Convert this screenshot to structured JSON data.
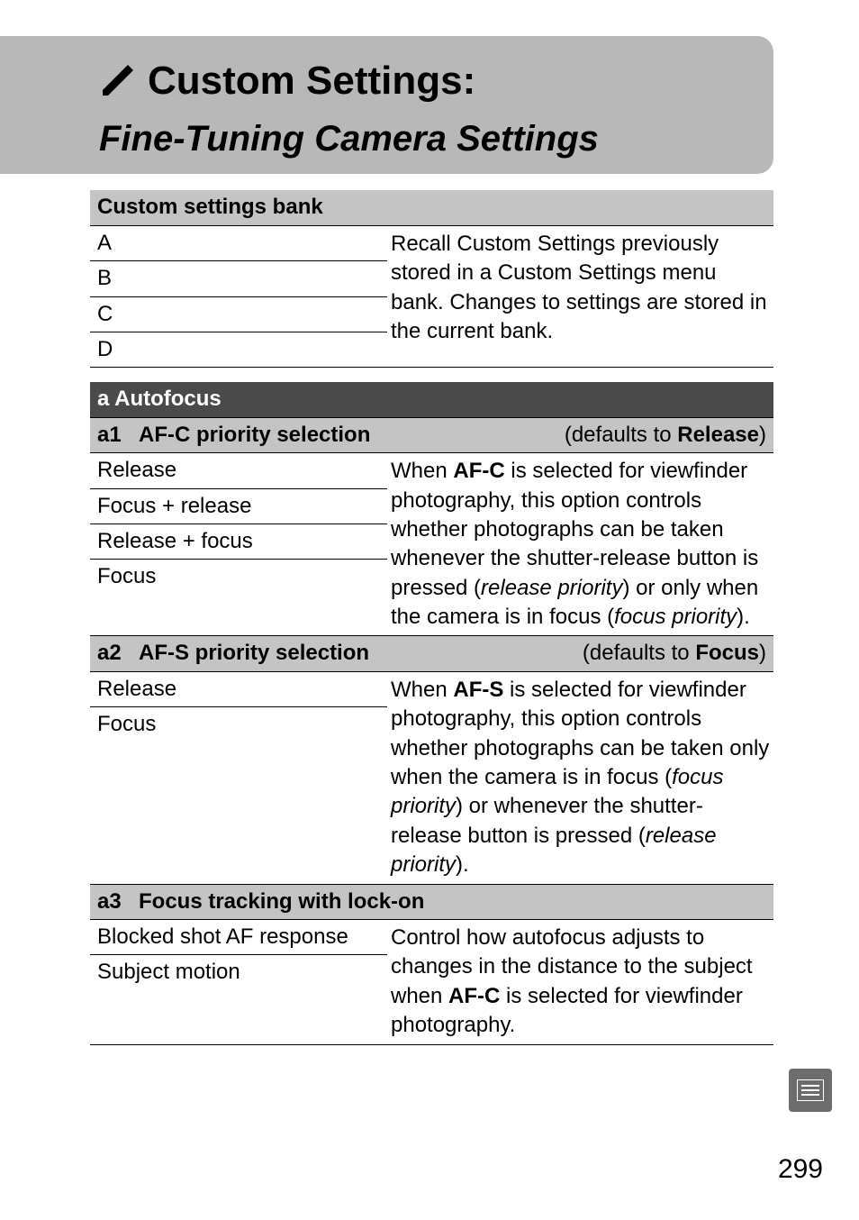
{
  "header": {
    "title": "Custom Settings:",
    "subtitle": "Fine-Tuning Camera Settings"
  },
  "bank": {
    "heading": "Custom settings bank",
    "options": [
      "A",
      "B",
      "C",
      "D"
    ],
    "desc_1": "Recall Custom Settings previously stored in a Custom Settings menu bank. Changes to settings are stored in the current bank."
  },
  "group_a": {
    "heading": "a Autofocus"
  },
  "a1": {
    "code": "a1",
    "title": "AF-C priority selection",
    "default_prefix": "(defaults to ",
    "default_value": "Release",
    "default_suffix": ")",
    "options": [
      "Release",
      "Focus + release",
      "Release + focus",
      "Focus"
    ],
    "desc_p1": "When ",
    "desc_afc": "AF-C",
    "desc_p2": " is selected for viewfinder photography, this option controls whether photographs can be taken whenever the shutter-release button is pressed (",
    "desc_em1": "release priority",
    "desc_p3": ") or only when the camera is in focus (",
    "desc_em2": "focus priority",
    "desc_p4": ")."
  },
  "a2": {
    "code": "a2",
    "title": "AF-S priority selection",
    "default_prefix": "(defaults to ",
    "default_value": "Focus",
    "default_suffix": ")",
    "options": [
      "Release",
      "Focus"
    ],
    "desc_p1": "When ",
    "desc_afs": "AF-S",
    "desc_p2": " is selected for viewfinder photography, this option controls whether photographs can be taken only when the camera is in focus (",
    "desc_em1": "focus priority",
    "desc_p3": ") or whenever the shutter-release button is pressed (",
    "desc_em2": "release priority",
    "desc_p4": ")."
  },
  "a3": {
    "code": "a3",
    "title": "Focus tracking with lock-on",
    "options": [
      "Blocked shot AF response",
      "Subject motion"
    ],
    "desc_p1": "Control how autofocus adjusts to changes in the distance to the subject when ",
    "desc_afc": "AF-C",
    "desc_p2": " is selected for viewfinder photography."
  },
  "page_number": "299"
}
